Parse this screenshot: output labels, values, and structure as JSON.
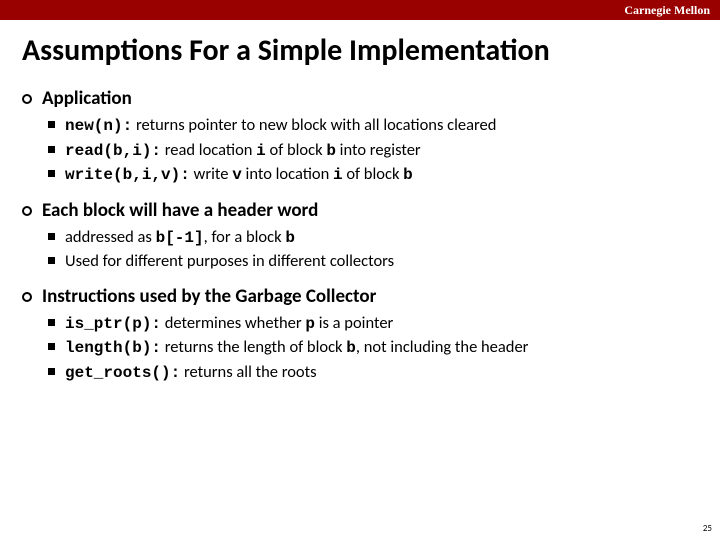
{
  "brand": "Carnegie Mellon",
  "title": "Assumptions For a Simple Implementation",
  "sections": [
    {
      "heading": "Application",
      "items": [
        {
          "code": "new(n):",
          "text": " returns pointer to new block with all locations cleared"
        },
        {
          "code": "read(b,i):",
          "text_html": " read location <code>i</code> of block <code>b</code> into register"
        },
        {
          "code": "write(b,i,v):",
          "text_html": " write <code>v</code> into location <code>i</code> of block <code>b</code>"
        }
      ]
    },
    {
      "heading": "Each block will have a header word",
      "items": [
        {
          "text_html": "addressed as <code>b[-1]</code>, for a block <code>b</code>"
        },
        {
          "text": "Used for different purposes in different collectors"
        }
      ]
    },
    {
      "heading": "Instructions used by the Garbage Collector",
      "items": [
        {
          "code": "is_ptr(p):",
          "text_html": " determines whether <code>p</code> is a pointer"
        },
        {
          "code": "length(b):",
          "text_html": " returns the length of block <code>b</code>, not including the header"
        },
        {
          "code": "get_roots():",
          "text": " returns all the roots"
        }
      ]
    }
  ],
  "page_number": "25"
}
